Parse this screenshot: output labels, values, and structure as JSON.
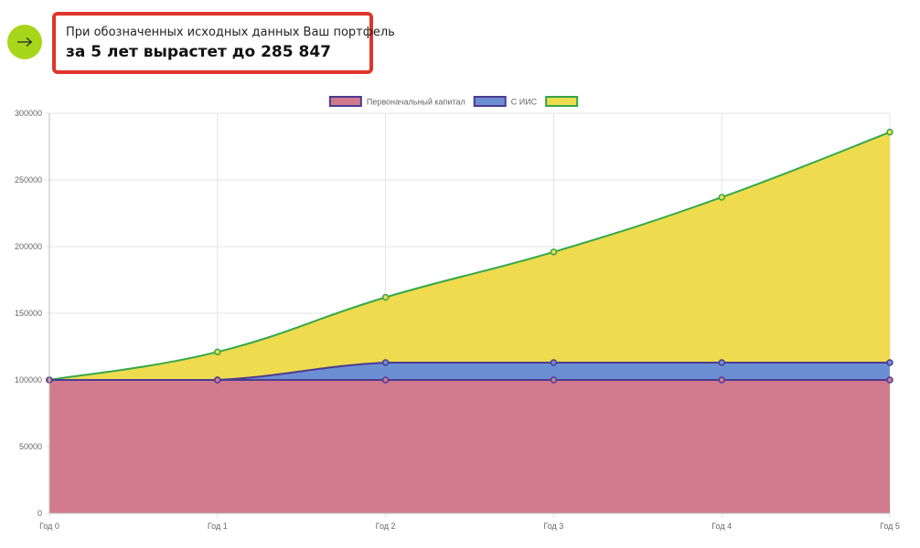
{
  "header": {
    "arrow_icon": "arrow-right-icon",
    "accent_color": "#a8d61a",
    "box_border_color": "#e0352b",
    "result_line1": "При обозначенных исходных данных Ваш портфель",
    "result_line2": "за 5 лет вырастет до 285 847"
  },
  "chart_data": {
    "type": "area",
    "title": "",
    "xlabel": "",
    "ylabel": "",
    "categories": [
      "Год 0",
      "Год 1",
      "Год 2",
      "Год 3",
      "Год 4",
      "Год 5"
    ],
    "ylim": [
      0,
      300000
    ],
    "yticks": [
      0,
      50000,
      100000,
      150000,
      200000,
      250000,
      300000
    ],
    "grid": true,
    "legend_position": "top",
    "series": [
      {
        "name": "Первоначальный капитал",
        "values": [
          100000,
          100000,
          100000,
          100000,
          100000,
          100000
        ],
        "fill": "#d17a8e",
        "stroke": "#4b3b91"
      },
      {
        "name": "С ИИС",
        "values": [
          100000,
          100000,
          113000,
          113000,
          113000,
          113000
        ],
        "fill": "#6c8fd4",
        "stroke": "#4b3b91"
      },
      {
        "name": "",
        "values": [
          100000,
          121000,
          162000,
          196000,
          237000,
          285847
        ],
        "fill": "#eedb4e",
        "stroke": "#33a84a"
      }
    ]
  }
}
